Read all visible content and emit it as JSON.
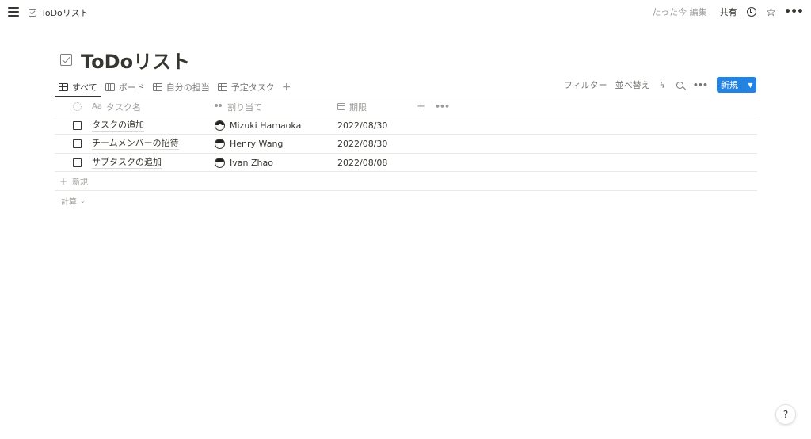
{
  "topbar": {
    "breadcrumb": "ToDoリスト",
    "edited": "たった今 編集",
    "share": "共有"
  },
  "page": {
    "title": "ToDoリスト"
  },
  "views": {
    "tabs": [
      {
        "label": "すべて",
        "icon": "table-icon",
        "active": true
      },
      {
        "label": "ボード",
        "icon": "board-icon",
        "active": false
      },
      {
        "label": "自分の担当",
        "icon": "table-icon",
        "active": false
      },
      {
        "label": "予定タスク",
        "icon": "table-icon",
        "active": false
      }
    ],
    "add": "+"
  },
  "toolbar": {
    "filter": "フィルター",
    "sort": "並べ替え",
    "new_label": "新規"
  },
  "table": {
    "headers": {
      "name": "タスク名",
      "name_icon_text": "Aa",
      "assign": "割り当て",
      "due": "期限"
    },
    "rows": [
      {
        "name": "タスクの追加",
        "assignee": "Mizuki Hamaoka",
        "due": "2022/08/30"
      },
      {
        "name": "チームメンバーの招待",
        "assignee": "Henry Wang",
        "due": "2022/08/30"
      },
      {
        "name": "サブタスクの追加",
        "assignee": "Ivan Zhao",
        "due": "2022/08/08"
      }
    ],
    "new_row": "新規",
    "calc": "計算"
  },
  "help": "?",
  "colors": {
    "accent": "#2383e2",
    "text": "#37352f",
    "muted": "#9b9a97"
  }
}
